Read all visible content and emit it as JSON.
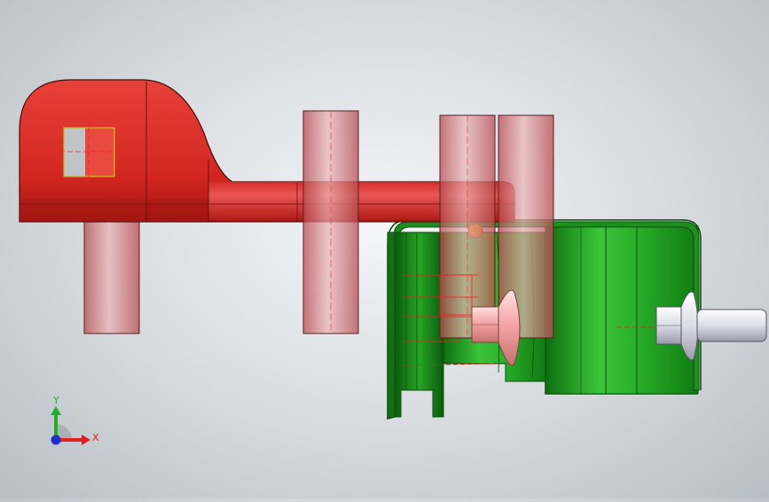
{
  "viewport": {
    "background": "#d6dade"
  },
  "model": {
    "part_colors": {
      "bracket": "#d42a24",
      "housing": "#1e9e1e",
      "transparent_pins": "#c44a4a",
      "bolts": "#e8e8ef",
      "sketch_lines": "#ff0000"
    },
    "parts": [
      "red-bracket",
      "transparent-pin-1",
      "transparent-pin-2",
      "transparent-pin-3",
      "transparent-pin-4",
      "green-housing",
      "bolt-left",
      "bolt-right"
    ]
  },
  "triad": {
    "y_label": "Y",
    "x_label": "X",
    "colors": {
      "x": "#e0201f",
      "y": "#1fb01f",
      "z": "#1e2fd0"
    }
  }
}
